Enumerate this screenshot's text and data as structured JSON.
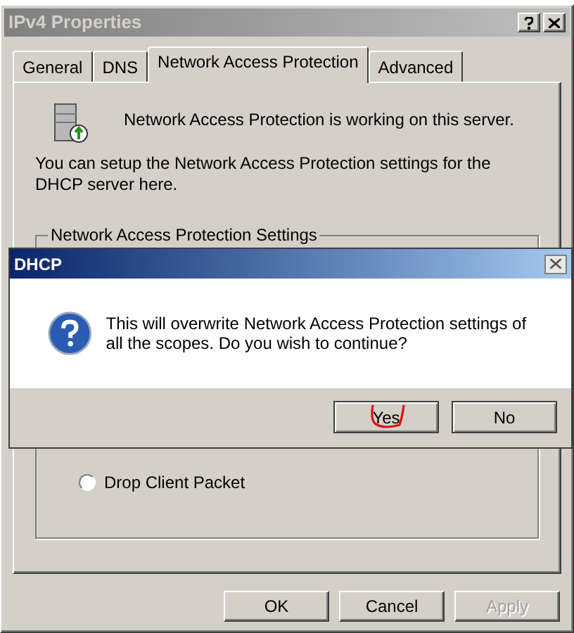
{
  "window": {
    "title": "IPv4 Properties"
  },
  "tabs": [
    {
      "label": "General",
      "selected": false
    },
    {
      "label": "DNS",
      "selected": false
    },
    {
      "label": "Network Access Protection",
      "selected": true
    },
    {
      "label": "Advanced",
      "selected": false
    }
  ],
  "status_text": "Network Access Protection is working on this server.",
  "description": "You can setup the Network Access Protection settings for the DHCP server here.",
  "group": {
    "title": "Network Access Protection Settings",
    "options": [
      {
        "label": "Drop Client Packet",
        "selected": false
      }
    ]
  },
  "buttons": [
    {
      "label": "OK",
      "disabled": false
    },
    {
      "label": "Cancel",
      "disabled": false
    },
    {
      "label": "Apply",
      "disabled": true
    }
  ],
  "message_box": {
    "title": "DHCP",
    "message": "This will overwrite Network Access Protection settings of all the scopes. Do you wish to continue?",
    "buttons": [
      {
        "label": "Yes",
        "circled": true
      },
      {
        "label": "No",
        "circled": false
      }
    ]
  }
}
